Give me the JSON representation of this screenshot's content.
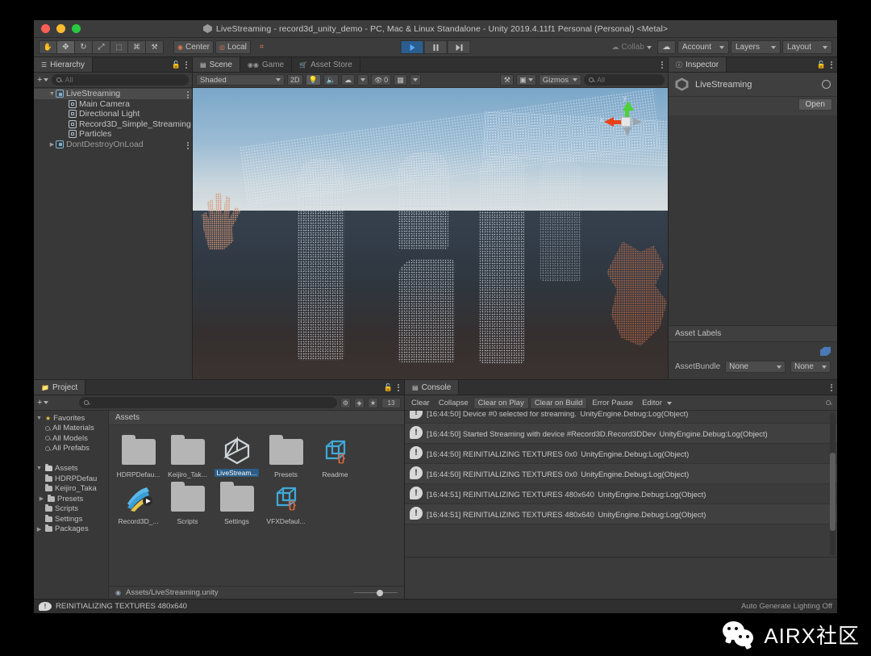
{
  "window": {
    "title": "LiveStreaming - record3d_unity_demo - PC, Mac & Linux Standalone - Unity 2019.4.11f1 Personal (Personal) <Metal>"
  },
  "toolbar": {
    "tools": [
      {
        "name": "hand-tool",
        "glyph": "✋"
      },
      {
        "name": "move-tool",
        "glyph": "✥"
      },
      {
        "name": "rotate-tool",
        "glyph": "↻"
      },
      {
        "name": "scale-tool",
        "glyph": "⤢"
      },
      {
        "name": "rect-tool",
        "glyph": "⬚"
      },
      {
        "name": "transform-tool",
        "glyph": "⌘"
      },
      {
        "name": "custom-tool",
        "glyph": "⚒"
      }
    ],
    "pivot_label": "Center",
    "space_label": "Local",
    "grid_label": "⌗",
    "play_label": "▶",
    "pause_label": "⏸",
    "step_label": "⏭",
    "collab_label": "Collab",
    "cloud_label": "☁",
    "account_label": "Account",
    "layers_label": "Layers",
    "layout_label": "Layout"
  },
  "hierarchy": {
    "tab_label": "Hierarchy",
    "add_label": "+",
    "search_placeholder": "All",
    "items": [
      {
        "label": "LiveStreaming",
        "depth": 1,
        "icon": "prefab-icon",
        "selected": true,
        "expanded": true,
        "kebab": true
      },
      {
        "label": "Main Camera",
        "depth": 2,
        "icon": "gameobject-icon",
        "selected": false,
        "expanded": false,
        "kebab": false
      },
      {
        "label": "Directional Light",
        "depth": 2,
        "icon": "gameobject-icon",
        "selected": false,
        "expanded": false,
        "kebab": false
      },
      {
        "label": "Record3D_Simple_Streaming",
        "depth": 2,
        "icon": "gameobject-icon",
        "selected": false,
        "expanded": false,
        "kebab": false
      },
      {
        "label": "Particles",
        "depth": 2,
        "icon": "gameobject-icon",
        "selected": false,
        "expanded": false,
        "kebab": false
      },
      {
        "label": "DontDestroyOnLoad",
        "depth": 1,
        "icon": "prefab-icon",
        "selected": false,
        "expanded": false,
        "kebab": true
      }
    ]
  },
  "scene": {
    "tabs": [
      {
        "label": "Scene",
        "selected": true,
        "icon": "grid-icon"
      },
      {
        "label": "Game",
        "selected": false,
        "icon": "gamepad-icon"
      },
      {
        "label": "Asset Store",
        "selected": false,
        "icon": "store-icon"
      }
    ],
    "shading_mode": "Shaded",
    "mode_2d": "2D",
    "light_icon": "💡",
    "audio_icon": "🔈",
    "fx_icon": "☁",
    "hidden_count": "0",
    "grid_icon": "▦",
    "camera_icon": "▣",
    "gizmos_label": "Gizmos",
    "search_placeholder": "All",
    "gizmo_axes": {
      "y": "y",
      "x": "x"
    }
  },
  "inspector": {
    "tab_label": "Inspector",
    "object_name": "LiveStreaming",
    "open_label": "Open",
    "asset_labels_title": "Asset Labels",
    "assetbundle_label": "AssetBundle",
    "assetbundle_value": "None",
    "assetbundle_variant": "None"
  },
  "project": {
    "tab_label": "Project",
    "add_label": "+",
    "search_placeholder": "",
    "filter_count": "13",
    "tree": [
      {
        "label": "Favorites",
        "depth": 0,
        "icon": "star-icon",
        "arrow": "▼"
      },
      {
        "label": "All Materials",
        "depth": 1,
        "icon": "search-icon",
        "arrow": ""
      },
      {
        "label": "All Models",
        "depth": 1,
        "icon": "search-icon",
        "arrow": ""
      },
      {
        "label": "All Prefabs",
        "depth": 1,
        "icon": "search-icon",
        "arrow": ""
      },
      {
        "label": "",
        "depth": 0,
        "icon": "",
        "arrow": ""
      },
      {
        "label": "Assets",
        "depth": 0,
        "icon": "folder-open-icon",
        "arrow": "▼"
      },
      {
        "label": "HDRPDefau",
        "depth": 1,
        "icon": "folder-icon",
        "arrow": ""
      },
      {
        "label": "Keijiro_Taka",
        "depth": 1,
        "icon": "folder-icon",
        "arrow": ""
      },
      {
        "label": "Presets",
        "depth": 1,
        "icon": "folder-icon",
        "arrow": "▶"
      },
      {
        "label": "Scripts",
        "depth": 1,
        "icon": "folder-icon",
        "arrow": ""
      },
      {
        "label": "Settings",
        "depth": 1,
        "icon": "folder-icon",
        "arrow": ""
      },
      {
        "label": "Packages",
        "depth": 0,
        "icon": "folder-icon",
        "arrow": "▶"
      }
    ],
    "grid_header": "Assets",
    "assets": [
      {
        "label": "HDRPDefau...",
        "type": "folder",
        "selected": false
      },
      {
        "label": "Keijiro_Tak...",
        "type": "folder",
        "selected": false
      },
      {
        "label": "LiveStream...",
        "type": "unity-scene",
        "selected": true
      },
      {
        "label": "Presets",
        "type": "folder",
        "selected": false
      },
      {
        "label": "Readme",
        "type": "scriptable-object",
        "selected": false
      },
      {
        "label": "Record3D_...",
        "type": "vfx-asset",
        "selected": false
      },
      {
        "label": "Scripts",
        "type": "folder",
        "selected": false
      },
      {
        "label": "Settings",
        "type": "folder",
        "selected": false
      },
      {
        "label": "VFXDefaul...",
        "type": "scriptable-object",
        "selected": false
      }
    ],
    "footer_path": "Assets/LiveStreaming.unity"
  },
  "console": {
    "tab_label": "Console",
    "buttons": [
      {
        "label": "Clear",
        "boxed": false
      },
      {
        "label": "Collapse",
        "boxed": false
      },
      {
        "label": "Clear on Play",
        "boxed": true
      },
      {
        "label": "Clear on Build",
        "boxed": true
      },
      {
        "label": "Error Pause",
        "boxed": false
      },
      {
        "label": "Editor",
        "boxed": false
      }
    ],
    "entries": [
      {
        "message": "[16:44:50] Device #0 selected for streaming.",
        "meta": "UnityEngine.Debug:Log(Object)",
        "partial": true
      },
      {
        "message": "[16:44:50] Started Streaming with device #Record3D.Record3DDev",
        "meta": "UnityEngine.Debug:Log(Object)",
        "partial": false
      },
      {
        "message": "[16:44:50] REINITIALIZING TEXTURES 0x0",
        "meta": "UnityEngine.Debug:Log(Object)",
        "partial": false
      },
      {
        "message": "[16:44:50] REINITIALIZING TEXTURES 0x0",
        "meta": "UnityEngine.Debug:Log(Object)",
        "partial": false
      },
      {
        "message": "[16:44:51] REINITIALIZING TEXTURES 480x640",
        "meta": "UnityEngine.Debug:Log(Object)",
        "partial": false
      },
      {
        "message": "[16:44:51] REINITIALIZING TEXTURES 480x640",
        "meta": "UnityEngine.Debug:Log(Object)",
        "partial": false
      }
    ]
  },
  "statusbar": {
    "message": "REINITIALIZING TEXTURES 480x640",
    "lighting_note": "Auto Generate Lighting Off"
  },
  "watermark": {
    "text": "AIRX社区"
  },
  "colors": {
    "accent_blue": "#2c5d87",
    "play_blue": "#2b5e8f",
    "axis_green": "#4cd137",
    "axis_red": "#e84118"
  }
}
